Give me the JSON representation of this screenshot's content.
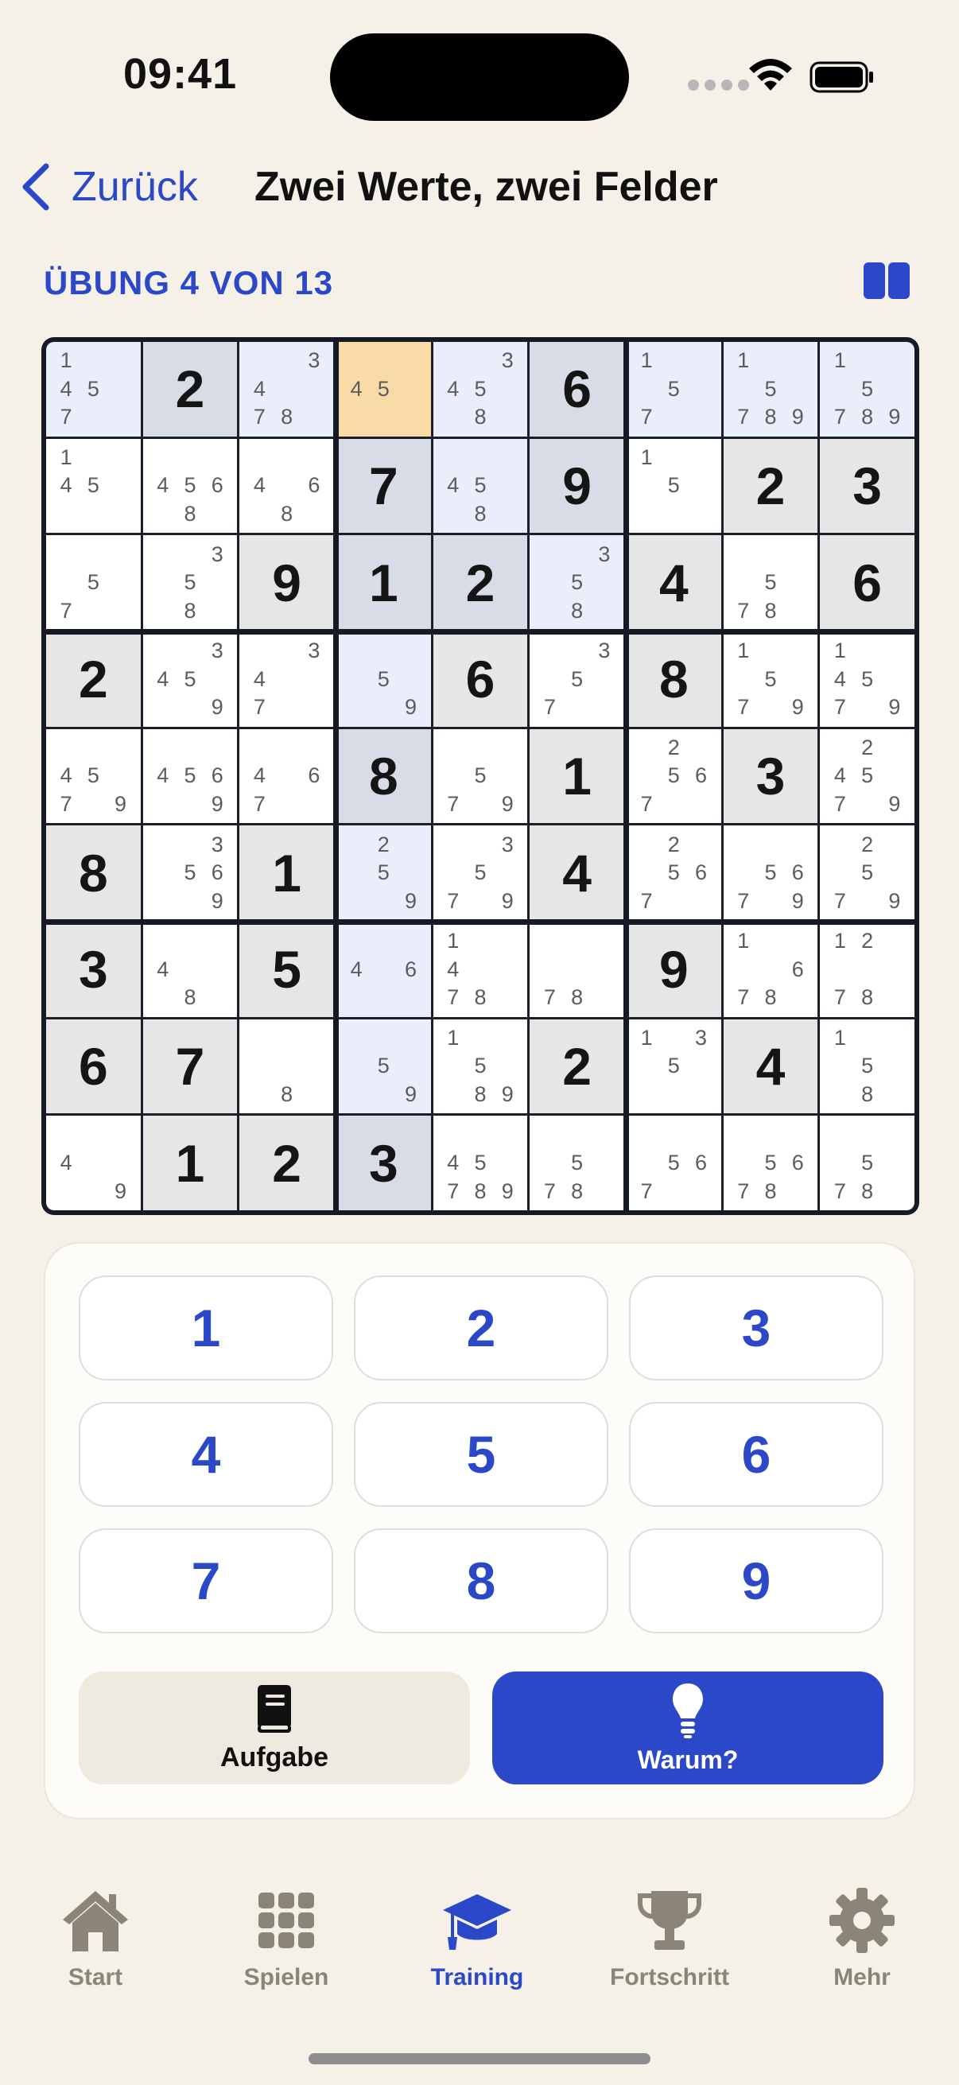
{
  "status": {
    "time": "09:41"
  },
  "nav": {
    "back_label": "Zurück",
    "title": "Zwei Werte, zwei Felder"
  },
  "exercise": {
    "label": "ÜBUNG 4 VON 13"
  },
  "board": {
    "cells": [
      [
        {
          "n": [
            1,
            4,
            5,
            7
          ],
          "bg": "peer"
        },
        {
          "v": 2,
          "bg": "peer-given"
        },
        {
          "n": [
            3,
            4,
            7,
            8
          ],
          "bg": "peer"
        },
        {
          "n": [
            4,
            5
          ],
          "bg": "selected"
        },
        {
          "n": [
            3,
            4,
            5,
            8
          ],
          "bg": "peer"
        },
        {
          "v": 6,
          "bg": "peer-given"
        },
        {
          "n": [
            1,
            5,
            7
          ],
          "bg": "peer"
        },
        {
          "n": [
            1,
            5,
            7,
            8,
            9
          ],
          "bg": "peer"
        },
        {
          "n": [
            1,
            5,
            7,
            8,
            9
          ],
          "bg": "peer"
        }
      ],
      [
        {
          "n": [
            1,
            4,
            5
          ],
          "bg": "white"
        },
        {
          "n": [
            4,
            5,
            6,
            8
          ],
          "bg": "white"
        },
        {
          "n": [
            4,
            6,
            8
          ],
          "bg": "white"
        },
        {
          "v": 7,
          "bg": "peer-given"
        },
        {
          "n": [
            4,
            5,
            8
          ],
          "bg": "peer"
        },
        {
          "v": 9,
          "bg": "peer-given"
        },
        {
          "n": [
            1,
            5
          ],
          "bg": "white"
        },
        {
          "v": 2,
          "bg": "given"
        },
        {
          "v": 3,
          "bg": "given"
        }
      ],
      [
        {
          "n": [
            5,
            7
          ],
          "bg": "white"
        },
        {
          "n": [
            3,
            5,
            8
          ],
          "bg": "white"
        },
        {
          "v": 9,
          "bg": "given"
        },
        {
          "v": 1,
          "bg": "peer-given"
        },
        {
          "v": 2,
          "bg": "peer-given"
        },
        {
          "n": [
            3,
            5,
            8
          ],
          "bg": "peer"
        },
        {
          "v": 4,
          "bg": "given"
        },
        {
          "n": [
            5,
            7,
            8
          ],
          "bg": "white"
        },
        {
          "v": 6,
          "bg": "given"
        }
      ],
      [
        {
          "v": 2,
          "bg": "given"
        },
        {
          "n": [
            3,
            4,
            5,
            9
          ],
          "bg": "white"
        },
        {
          "n": [
            3,
            4,
            7
          ],
          "bg": "white"
        },
        {
          "n": [
            5,
            9
          ],
          "bg": "peer"
        },
        {
          "v": 6,
          "bg": "given"
        },
        {
          "n": [
            3,
            5,
            7
          ],
          "bg": "white"
        },
        {
          "v": 8,
          "bg": "given"
        },
        {
          "n": [
            1,
            5,
            7,
            9
          ],
          "bg": "white"
        },
        {
          "n": [
            1,
            4,
            5,
            7,
            9
          ],
          "bg": "white"
        }
      ],
      [
        {
          "n": [
            4,
            5,
            7,
            9
          ],
          "bg": "white"
        },
        {
          "n": [
            4,
            5,
            6,
            9
          ],
          "bg": "white"
        },
        {
          "n": [
            4,
            6,
            7
          ],
          "bg": "white"
        },
        {
          "v": 8,
          "bg": "peer-given"
        },
        {
          "n": [
            5,
            7,
            9
          ],
          "bg": "white"
        },
        {
          "v": 1,
          "bg": "given"
        },
        {
          "n": [
            2,
            5,
            6,
            7
          ],
          "bg": "white"
        },
        {
          "v": 3,
          "bg": "given"
        },
        {
          "n": [
            2,
            4,
            5,
            7,
            9
          ],
          "bg": "white"
        }
      ],
      [
        {
          "v": 8,
          "bg": "given"
        },
        {
          "n": [
            3,
            5,
            6,
            9
          ],
          "bg": "white"
        },
        {
          "v": 1,
          "bg": "given"
        },
        {
          "n": [
            2,
            5,
            9
          ],
          "bg": "peer"
        },
        {
          "n": [
            3,
            5,
            7,
            9
          ],
          "bg": "white"
        },
        {
          "v": 4,
          "bg": "given"
        },
        {
          "n": [
            2,
            5,
            6,
            7
          ],
          "bg": "white"
        },
        {
          "n": [
            5,
            6,
            7,
            9
          ],
          "bg": "white"
        },
        {
          "n": [
            2,
            5,
            7,
            9
          ],
          "bg": "white"
        }
      ],
      [
        {
          "v": 3,
          "bg": "given"
        },
        {
          "n": [
            4,
            8
          ],
          "bg": "white"
        },
        {
          "v": 5,
          "bg": "given"
        },
        {
          "n": [
            4,
            6
          ],
          "bg": "peer"
        },
        {
          "n": [
            1,
            4,
            7,
            8
          ],
          "bg": "white"
        },
        {
          "n": [
            7,
            8
          ],
          "bg": "white"
        },
        {
          "v": 9,
          "bg": "given"
        },
        {
          "n": [
            1,
            6,
            7,
            8
          ],
          "bg": "white"
        },
        {
          "n": [
            1,
            2,
            7,
            8
          ],
          "bg": "white"
        }
      ],
      [
        {
          "v": 6,
          "bg": "given"
        },
        {
          "v": 7,
          "bg": "given"
        },
        {
          "n": [
            8
          ],
          "bg": "white"
        },
        {
          "n": [
            5,
            9
          ],
          "bg": "peer"
        },
        {
          "n": [
            1,
            5,
            8,
            9
          ],
          "bg": "white"
        },
        {
          "v": 2,
          "bg": "given"
        },
        {
          "n": [
            1,
            3,
            5
          ],
          "bg": "white"
        },
        {
          "v": 4,
          "bg": "given"
        },
        {
          "n": [
            1,
            5,
            8
          ],
          "bg": "white"
        }
      ],
      [
        {
          "n": [
            4,
            9
          ],
          "bg": "white"
        },
        {
          "v": 1,
          "bg": "given"
        },
        {
          "v": 2,
          "bg": "given"
        },
        {
          "v": 3,
          "bg": "peer-given"
        },
        {
          "n": [
            4,
            5,
            7,
            8,
            9
          ],
          "bg": "white"
        },
        {
          "n": [
            5,
            7,
            8
          ],
          "bg": "white"
        },
        {
          "n": [
            5,
            6,
            7
          ],
          "bg": "white"
        },
        {
          "n": [
            5,
            6,
            7,
            8
          ],
          "bg": "white"
        },
        {
          "n": [
            5,
            7,
            8
          ],
          "bg": "white"
        }
      ]
    ]
  },
  "keypad": {
    "digits": [
      "1",
      "2",
      "3",
      "4",
      "5",
      "6",
      "7",
      "8",
      "9"
    ],
    "task_label": "Aufgabe",
    "why_label": "Warum?"
  },
  "tabs": [
    {
      "label": "Start",
      "icon": "house-icon",
      "active": false
    },
    {
      "label": "Spielen",
      "icon": "grid-icon",
      "active": false
    },
    {
      "label": "Training",
      "icon": "graduation-cap-icon",
      "active": true
    },
    {
      "label": "Fortschritt",
      "icon": "trophy-icon",
      "active": false
    },
    {
      "label": "Mehr",
      "icon": "gear-icon",
      "active": false
    }
  ],
  "colors": {
    "accent": "#2a48c8",
    "background": "#f5f1e8",
    "selected_cell": "#f8dba6",
    "peer_cell": "#eaeefa",
    "given_cell": "#e6e6e6",
    "inactive_tab": "#8a8577"
  }
}
